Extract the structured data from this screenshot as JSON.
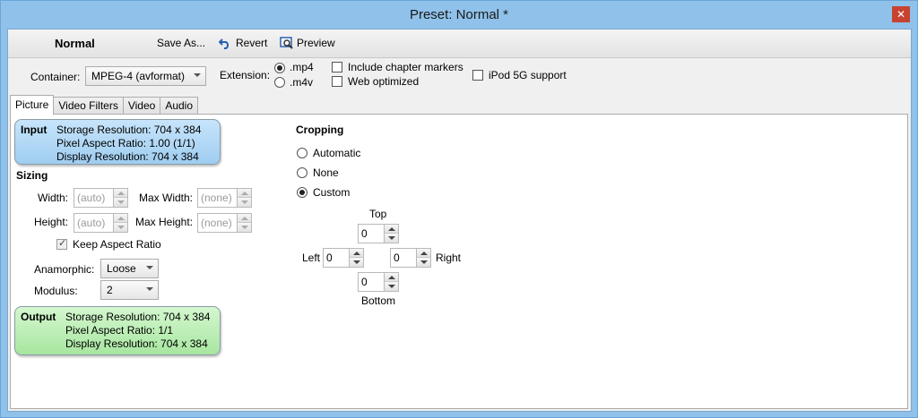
{
  "window": {
    "title": "Preset: Normal *",
    "close_glyph": "✕"
  },
  "toolbar": {
    "preset_name": "Normal",
    "save_as": "Save As...",
    "revert": "Revert",
    "preview": "Preview"
  },
  "container": {
    "label": "Container:",
    "value": "MPEG-4 (avformat)",
    "extension_label": "Extension:",
    "ext_mp4": ".mp4",
    "ext_m4v": ".m4v",
    "selected_extension": ".mp4",
    "include_chapter_markers": "Include chapter markers",
    "web_optimized": "Web optimized",
    "ipod_5g_support": "iPod 5G support"
  },
  "tabs": [
    {
      "label": "Picture",
      "active": true
    },
    {
      "label": "Video Filters",
      "active": false
    },
    {
      "label": "Video",
      "active": false
    },
    {
      "label": "Audio",
      "active": false
    }
  ],
  "input_info": {
    "title": "Input",
    "storage_resolution": "Storage Resolution: 704 x 384",
    "pixel_aspect_ratio": "Pixel Aspect Ratio:    1.00 (1/1)",
    "display_resolution": "Display Resolution:  704 x 384"
  },
  "sizing": {
    "title": "Sizing",
    "width_label": "Width:",
    "width_value": "(auto)",
    "max_width_label": "Max Width:",
    "max_width_value": "(none)",
    "height_label": "Height:",
    "height_value": "(auto)",
    "max_height_label": "Max Height:",
    "max_height_value": "(none)",
    "keep_aspect_ratio": "Keep Aspect Ratio",
    "anamorphic_label": "Anamorphic:",
    "anamorphic_value": "Loose",
    "modulus_label": "Modulus:",
    "modulus_value": "2"
  },
  "output_info": {
    "title": "Output",
    "storage_resolution": "Storage Resolution: 704 x 384",
    "pixel_aspect_ratio": "Pixel Aspect Ratio:    1/1",
    "display_resolution": "Display Resolution:  704 x 384"
  },
  "cropping": {
    "title": "Cropping",
    "automatic": "Automatic",
    "none": "None",
    "custom": "Custom",
    "selected": "Custom",
    "top_label": "Top",
    "top_value": "0",
    "left_label": "Left",
    "left_value": "0",
    "right_label": "Right",
    "right_value": "0",
    "bottom_label": "Bottom",
    "bottom_value": "0"
  },
  "colors": {
    "window_frame": "#8fc1ea",
    "close_button": "#c7432f",
    "input_box": "#b3d9f6",
    "output_box": "#bff0b8"
  }
}
